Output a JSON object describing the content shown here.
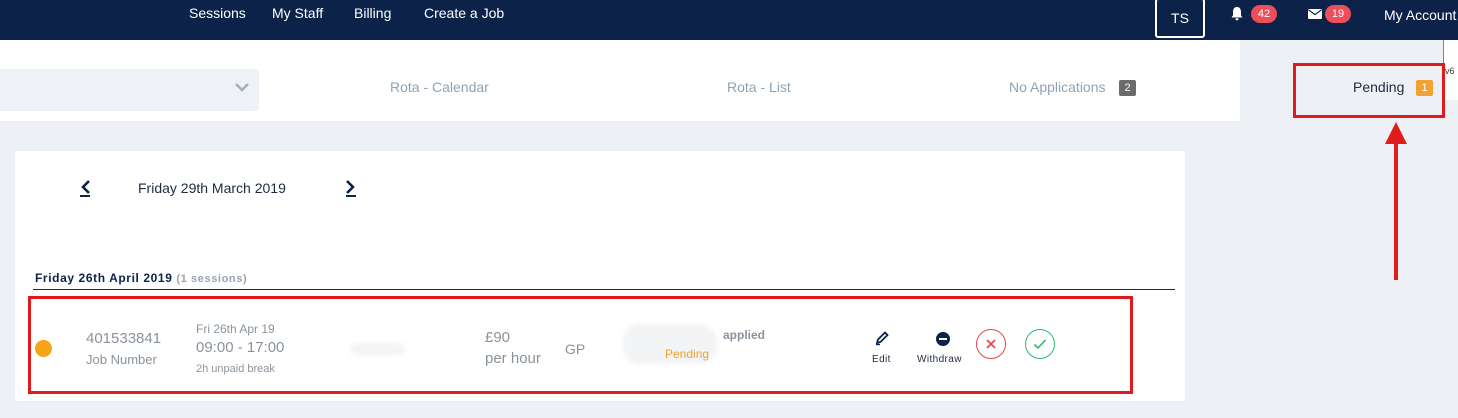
{
  "nav": {
    "links": [
      "Sessions",
      "My Staff",
      "Billing",
      "Create a Job"
    ],
    "user_initials": "TS",
    "notifications_count": "42",
    "messages_count": "19",
    "account_label": "My Account",
    "edge_text": "v6"
  },
  "tabs": {
    "calendar": "Rota - Calendar",
    "list": "Rota - List",
    "no_applications": "No Applications",
    "no_applications_count": "2",
    "pending": "Pending",
    "pending_count": "1"
  },
  "date_nav": {
    "current_date": "Friday 29th March 2019"
  },
  "section": {
    "title": "Friday 26th April 2019",
    "subtitle": "(1 sessions)"
  },
  "session": {
    "job_number": "401533841",
    "job_number_label": "Job Number",
    "date": "Fri 26th Apr 19",
    "time": "09:00 - 17:00",
    "break": "2h unpaid break",
    "rate": "£90",
    "rate_unit": "per hour",
    "role": "GP",
    "applied_label": "applied",
    "status": "Pending",
    "actions": {
      "edit": "Edit",
      "withdraw": "Withdraw"
    }
  },
  "colors": {
    "navy": "#0c2249",
    "status_pending": "#f0a330",
    "badge_red": "#ee4d5a",
    "annotation_red": "#e01b1b",
    "reject": "#e8434c",
    "accept": "#2eb872"
  },
  "icons": [
    "bell-icon",
    "envelope-icon",
    "chevron-down-icon",
    "chevron-left-icon",
    "chevron-right-icon",
    "pencil-icon",
    "minus-circle-icon",
    "x-circle-icon",
    "check-circle-icon"
  ]
}
